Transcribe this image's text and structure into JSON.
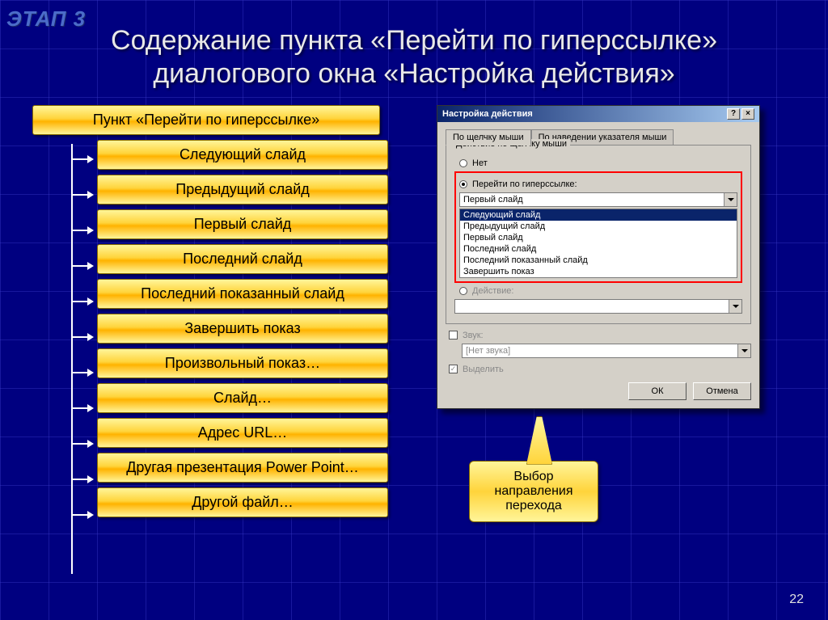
{
  "watermark": "ЭТАП 3",
  "title_line1": "Содержание пункта «Перейти по гиперссылке»",
  "title_line2": "диалогового окна «Настройка действия»",
  "header_bar": "Пункт «Перейти по гиперссылке»",
  "options": [
    "Следующий слайд",
    "Предыдущий слайд",
    "Первый слайд",
    "Последний слайд",
    "Последний показанный слайд",
    "Завершить показ",
    "Произвольный показ…",
    "Слайд…",
    "Адрес URL…",
    "Другая презентация Power Point…",
    "Другой файл…"
  ],
  "dialog": {
    "title": "Настройка действия",
    "tab_click": "По щелчку мыши",
    "tab_hover": "По наведении указателя мыши",
    "group_label": "Действие по щелчку мыши",
    "radio_none": "Нет",
    "radio_hyperlink": "Перейти по гиперссылке:",
    "combo_value": "Первый слайд",
    "list_items": [
      "Следующий слайд",
      "Предыдущий слайд",
      "Первый слайд",
      "Последний слайд",
      "Последний показанный слайд",
      "Завершить показ"
    ],
    "radio_action_disabled": "Действие:",
    "check_sound": "Звук:",
    "sound_value": "[Нет звука]",
    "check_highlight": "Выделить",
    "btn_ok": "ОК",
    "btn_cancel": "Отмена"
  },
  "callout": "Выбор направления перехода",
  "page_number": "22"
}
